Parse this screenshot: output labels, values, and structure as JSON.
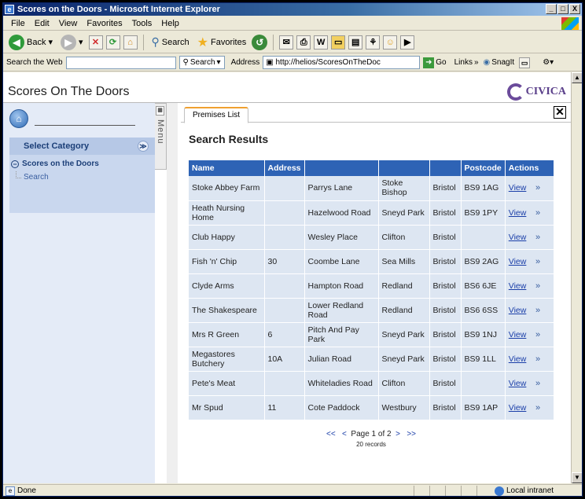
{
  "window": {
    "title": "Scores on the Doors - Microsoft Internet Explorer",
    "controls": [
      "_",
      "□",
      "X"
    ]
  },
  "menu": [
    "File",
    "Edit",
    "View",
    "Favorites",
    "Tools",
    "Help"
  ],
  "toolbar": {
    "back": "Back",
    "search": "Search",
    "favorites": "Favorites"
  },
  "searchbar": {
    "label": "Search the Web",
    "search_btn": "Search",
    "address_label": "Address",
    "address_value": "http://helios/ScoresOnTheDoc",
    "go": "Go",
    "links": "Links",
    "snagit": "SnagIt"
  },
  "page": {
    "title": "Scores On The Doors",
    "brand": "CIVICA"
  },
  "sidebar": {
    "select_category": "Select Category",
    "category": "Scores on the Doors",
    "leaf": "Search",
    "menu_tab": "Menu"
  },
  "tabs": {
    "active": "Premises List"
  },
  "results": {
    "title": "Search Results",
    "columns": [
      "Name",
      "Address",
      "",
      "",
      "",
      "Postcode",
      "Actions"
    ],
    "rows": [
      [
        "Stoke Abbey Farm",
        "",
        "Parrys Lane",
        "Stoke Bishop",
        "Bristol",
        "BS9 1AG",
        "View"
      ],
      [
        "Heath Nursing Home",
        "",
        "Hazelwood Road",
        "Sneyd Park",
        "Bristol",
        "BS9 1PY",
        "View"
      ],
      [
        "Club Happy",
        "",
        "Wesley Place",
        "Clifton",
        "Bristol",
        "",
        "View"
      ],
      [
        "Fish 'n' Chip",
        "30",
        "Coombe Lane",
        "Sea Mills",
        "Bristol",
        "BS9 2AG",
        "View"
      ],
      [
        "Clyde Arms",
        "",
        "Hampton Road",
        "Redland",
        "Bristol",
        "BS6 6JE",
        "View"
      ],
      [
        "The Shakespeare",
        "",
        "Lower Redland Road",
        "Redland",
        "Bristol",
        "BS6 6SS",
        "View"
      ],
      [
        "Mrs R Green",
        "6",
        "Pitch And Pay Park",
        "Sneyd Park",
        "Bristol",
        "BS9 1NJ",
        "View"
      ],
      [
        "Megastores Butchery",
        "10A",
        "Julian Road",
        "Sneyd Park",
        "Bristol",
        "BS9 1LL",
        "View"
      ],
      [
        "Pete's Meat",
        "",
        "Whiteladies Road",
        "Clifton",
        "Bristol",
        "",
        "View"
      ],
      [
        "Mr Spud",
        "11",
        "Cote Paddock",
        "Westbury",
        "Bristol",
        "BS9 1AP",
        "View"
      ]
    ],
    "row_action_icon": "»",
    "pager": {
      "first": "<<",
      "prev": "<",
      "info": "Page 1 of 2",
      "next": ">",
      "last": ">>"
    },
    "records": "20 records"
  },
  "status": {
    "text": "Done",
    "zone": "Local intranet"
  }
}
